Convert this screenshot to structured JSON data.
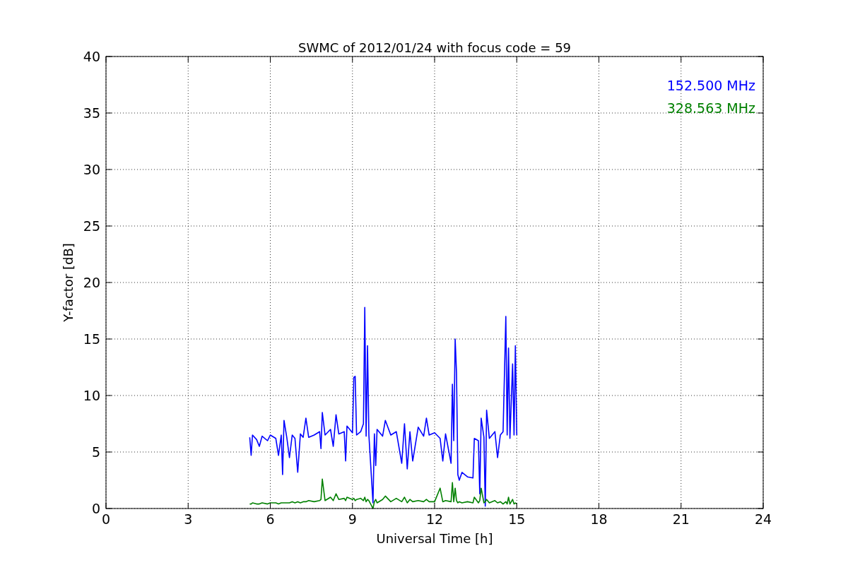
{
  "chart": {
    "chart_data": {
      "type": "line",
      "title": "SWMC of 2012/01/24 with focus code = 59",
      "xlabel": "Universal Time [h]",
      "ylabel": "Y-factor [dB]",
      "x": [
        5.25,
        5.3,
        5.35,
        5.5,
        5.6,
        5.7,
        5.9,
        6.0,
        6.2,
        6.3,
        6.4,
        6.45,
        6.5,
        6.6,
        6.7,
        6.8,
        6.9,
        7.0,
        7.1,
        7.2,
        7.3,
        7.4,
        7.6,
        7.8,
        7.85,
        7.9,
        8.0,
        8.2,
        8.3,
        8.4,
        8.5,
        8.7,
        8.75,
        8.8,
        9.0,
        9.05,
        9.1,
        9.15,
        9.3,
        9.4,
        9.45,
        9.5,
        9.55,
        9.6,
        9.75,
        9.8,
        9.85,
        9.9,
        10.1,
        10.2,
        10.4,
        10.6,
        10.8,
        10.9,
        11.0,
        11.1,
        11.2,
        11.4,
        11.6,
        11.7,
        11.8,
        12.0,
        12.2,
        12.3,
        12.4,
        12.6,
        12.65,
        12.7,
        12.75,
        12.8,
        12.85,
        12.9,
        13.0,
        13.2,
        13.4,
        13.45,
        13.6,
        13.65,
        13.7,
        13.8,
        13.85,
        13.9,
        14.0,
        14.2,
        14.3,
        14.4,
        14.5,
        14.6,
        14.65,
        14.7,
        14.75,
        14.85,
        14.9,
        14.95,
        15.0
      ],
      "series": [
        {
          "name": "152.500 MHz",
          "color": "#0000ff",
          "values": [
            6.3,
            4.7,
            6.5,
            6.1,
            5.5,
            6.4,
            6.0,
            6.5,
            6.2,
            4.7,
            6.5,
            3.0,
            7.8,
            6.3,
            4.5,
            6.5,
            6.2,
            3.2,
            6.6,
            6.3,
            8.0,
            6.3,
            6.5,
            6.8,
            5.3,
            8.5,
            6.5,
            7.0,
            5.5,
            8.3,
            6.6,
            6.8,
            4.2,
            7.3,
            6.7,
            11.6,
            11.7,
            6.5,
            6.8,
            7.5,
            17.8,
            6.4,
            14.4,
            6.5,
            0.5,
            6.6,
            3.8,
            7.0,
            6.4,
            7.8,
            6.5,
            6.8,
            4.0,
            7.5,
            3.5,
            6.8,
            4.2,
            7.2,
            6.4,
            8.0,
            6.5,
            6.7,
            6.2,
            4.2,
            6.6,
            4.0,
            11.0,
            6.0,
            15.0,
            12.0,
            3.0,
            2.5,
            3.2,
            2.8,
            2.7,
            6.2,
            6.0,
            1.3,
            8.0,
            6.3,
            0.2,
            8.7,
            6.2,
            6.8,
            4.5,
            6.5,
            6.8,
            17.0,
            6.5,
            14.2,
            6.2,
            12.8,
            6.5,
            14.4,
            6.5
          ]
        },
        {
          "name": "328.563 MHz",
          "color": "#008000",
          "values": [
            0.4,
            0.4,
            0.5,
            0.4,
            0.4,
            0.5,
            0.4,
            0.5,
            0.5,
            0.4,
            0.5,
            0.5,
            0.5,
            0.5,
            0.5,
            0.6,
            0.5,
            0.6,
            0.5,
            0.6,
            0.6,
            0.7,
            0.6,
            0.7,
            0.8,
            2.6,
            0.7,
            1.0,
            0.7,
            1.3,
            0.8,
            0.9,
            0.7,
            1.0,
            0.8,
            0.9,
            0.7,
            0.8,
            0.9,
            0.7,
            1.0,
            0.6,
            0.8,
            0.7,
            0.0,
            0.6,
            0.8,
            0.5,
            0.8,
            1.1,
            0.6,
            0.9,
            0.6,
            1.0,
            0.5,
            0.8,
            0.6,
            0.7,
            0.6,
            0.8,
            0.6,
            0.6,
            1.8,
            0.6,
            0.7,
            0.6,
            2.3,
            0.6,
            1.8,
            0.7,
            0.5,
            0.6,
            0.5,
            0.6,
            0.5,
            1.0,
            0.5,
            0.7,
            1.8,
            0.5,
            0.6,
            0.8,
            0.5,
            0.7,
            0.5,
            0.6,
            0.4,
            0.6,
            0.4,
            1.0,
            0.4,
            0.8,
            0.4,
            0.5,
            0.4
          ]
        }
      ],
      "grid": true,
      "xlim": [
        0,
        24
      ],
      "ylim": [
        0,
        40
      ],
      "xticks": [
        0,
        3,
        6,
        9,
        12,
        15,
        18,
        21,
        24
      ],
      "yticks": [
        0,
        5,
        10,
        15,
        20,
        25,
        30,
        35,
        40
      ]
    }
  }
}
